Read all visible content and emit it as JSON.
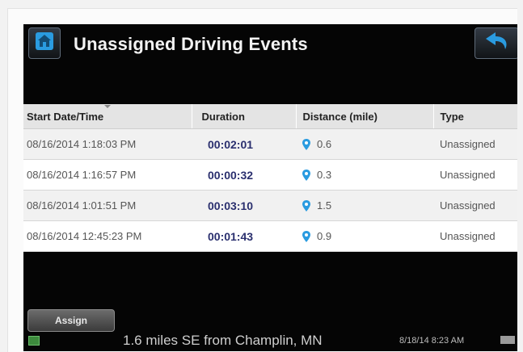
{
  "header": {
    "title": "Unassigned Driving Events",
    "home_icon": "home-icon",
    "back_icon": "back-arrow-icon"
  },
  "table": {
    "columns": [
      "Start Date/Time",
      "Duration",
      "Distance (mile)",
      "Type"
    ],
    "rows": [
      {
        "start": "08/16/2014 1:18:03 PM",
        "duration": "00:02:01",
        "distance": "0.6",
        "type": "Unassigned"
      },
      {
        "start": "08/16/2014 1:16:57 PM",
        "duration": "00:00:32",
        "distance": "0.3",
        "type": "Unassigned"
      },
      {
        "start": "08/16/2014 1:01:51 PM",
        "duration": "00:03:10",
        "distance": "1.5",
        "type": "Unassigned"
      },
      {
        "start": "08/16/2014 12:45:23 PM",
        "duration": "00:01:43",
        "distance": "0.9",
        "type": "Unassigned"
      }
    ]
  },
  "footer": {
    "assign_label": "Assign",
    "location": "1.6 miles SE from Champlin, MN",
    "timestamp": "8/18/14 8:23 AM"
  },
  "colors": {
    "accent": "#2a9be0",
    "duration_text": "#2a2f6e",
    "background": "#050505"
  }
}
